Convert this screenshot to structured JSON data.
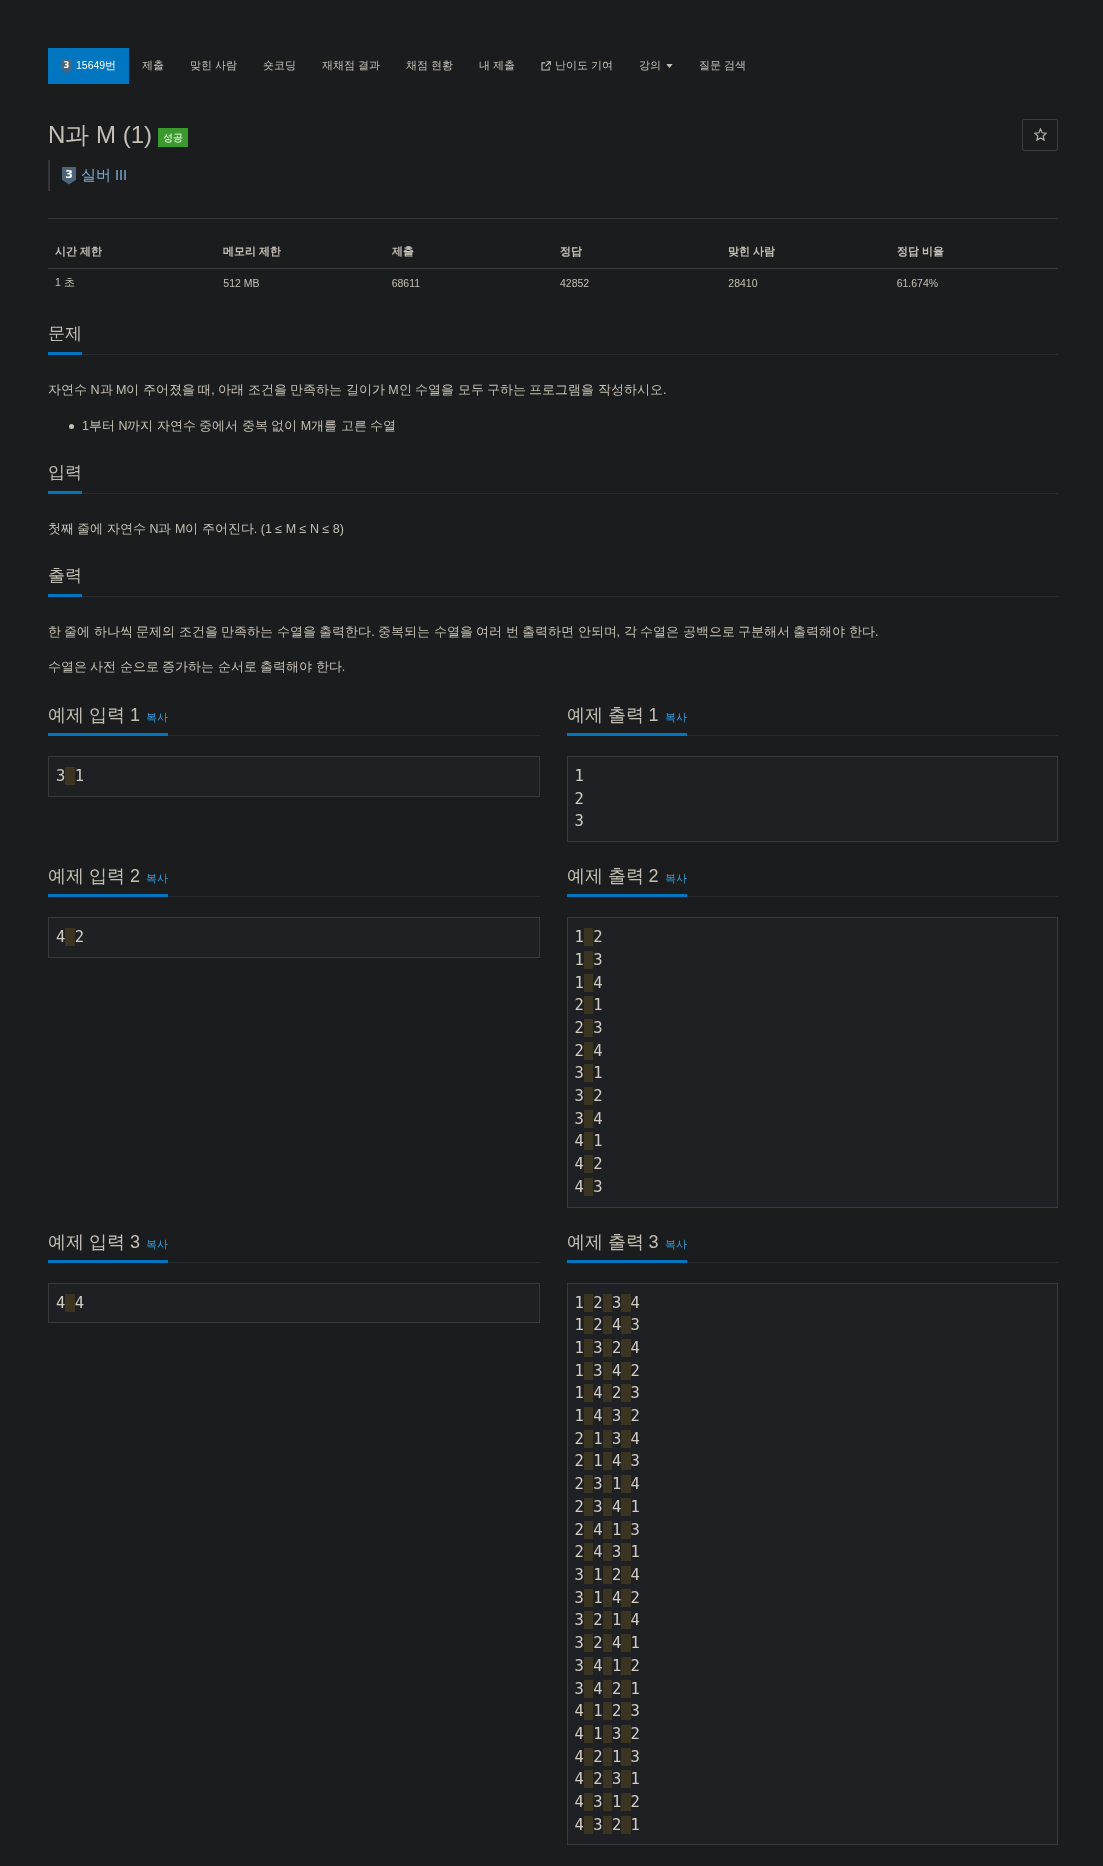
{
  "nav": [
    {
      "kind": "problem",
      "badge": "3",
      "label": "15649번",
      "selected": true
    },
    {
      "kind": "link",
      "label": "제출",
      "selected": false
    },
    {
      "kind": "link",
      "label": "맞힌 사람",
      "selected": false
    },
    {
      "kind": "link",
      "label": "숏코딩",
      "selected": false
    },
    {
      "kind": "link",
      "label": "재채점 결과",
      "selected": false
    },
    {
      "kind": "link",
      "label": "채점 현황",
      "selected": false
    },
    {
      "kind": "link",
      "label": "내 제출",
      "selected": false
    },
    {
      "kind": "external",
      "label": "난이도 기여",
      "selected": false
    },
    {
      "kind": "dropdown",
      "label": "강의",
      "selected": false
    },
    {
      "kind": "link",
      "label": "질문 검색",
      "selected": false
    }
  ],
  "title": {
    "text": "N과 M (1)",
    "badge": "성공"
  },
  "tier": {
    "level": "3",
    "name": "실버 III"
  },
  "table": {
    "columns": [
      "시간 제한",
      "메모리 제한",
      "제출",
      "정답",
      "맞힌 사람",
      "정답 비율"
    ],
    "rows": [
      [
        "1 초",
        "512 MB",
        "68611",
        "42852",
        "28410",
        "61.674%"
      ]
    ]
  },
  "sections": [
    {
      "title": "문제",
      "paragraphs": [
        "자연수 N과 M이 주어졌을 때, 아래 조건을 만족하는 길이가 M인 수열을 모두 구하는 프로그램을 작성하시오."
      ],
      "bullets": [
        "1부터 N까지 자연수 중에서 중복 없이 M개를 고른 수열"
      ]
    },
    {
      "title": "입력",
      "paragraphs": [
        "첫째 줄에 자연수 N과 M이 주어진다. (1 ≤ M ≤ N ≤ 8)"
      ]
    },
    {
      "title": "출력",
      "paragraphs": [
        "한 줄에 하나씩 문제의 조건을 만족하는 수열을 출력한다. 중복되는 수열을 여러 번 출력하면 안되며, 각 수열은 공백으로 구분해서 출력해야 한다.",
        "수열은 사전 순으로 증가하는 순서로 출력해야 한다."
      ]
    }
  ],
  "samples": [
    {
      "input": {
        "title": "예제 입력 1",
        "copy": "복사",
        "lines": [
          "3 1"
        ]
      },
      "output": {
        "title": "예제 출력 1",
        "copy": "복사",
        "lines": [
          "1",
          "2",
          "3"
        ]
      }
    },
    {
      "input": {
        "title": "예제 입력 2",
        "copy": "복사",
        "lines": [
          "4 2"
        ]
      },
      "output": {
        "title": "예제 출력 2",
        "copy": "복사",
        "lines": [
          "1 2",
          "1 3",
          "1 4",
          "2 1",
          "2 3",
          "2 4",
          "3 1",
          "3 2",
          "3 4",
          "4 1",
          "4 2",
          "4 3"
        ]
      }
    },
    {
      "input": {
        "title": "예제 입력 3",
        "copy": "복사",
        "lines": [
          "4 4"
        ]
      },
      "output": {
        "title": "예제 출력 3",
        "copy": "복사",
        "lines": [
          "1 2 3 4",
          "1 2 4 3",
          "1 3 2 4",
          "1 3 4 2",
          "1 4 2 3",
          "1 4 3 2",
          "2 1 3 4",
          "2 1 4 3",
          "2 3 1 4",
          "2 3 4 1",
          "2 4 1 3",
          "2 4 3 1",
          "3 1 2 4",
          "3 1 4 2",
          "3 2 1 4",
          "3 2 4 1",
          "3 4 1 2",
          "3 4 2 1",
          "4 1 2 3",
          "4 1 3 2",
          "4 2 1 3",
          "4 2 3 1",
          "4 3 1 2",
          "4 3 2 1"
        ]
      }
    }
  ]
}
